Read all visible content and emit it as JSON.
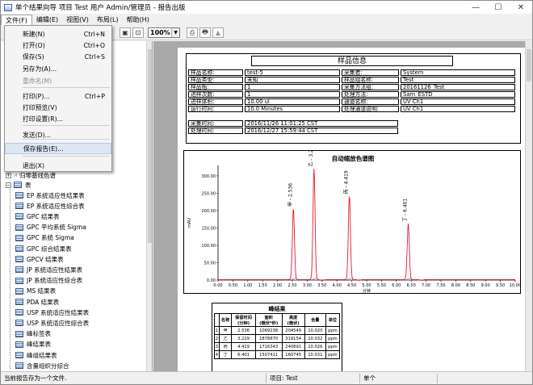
{
  "window": {
    "title": "单个结果向导 项目 Test 用户 Admin/管理员 - 报告出版",
    "buttons": [
      "—",
      "☐",
      "✕"
    ]
  },
  "menubar": [
    "文件(F)",
    "编辑(E)",
    "视图(V)",
    "布局(L)",
    "帮助(H)"
  ],
  "toolbar": {
    "zoom": "100%"
  },
  "file_menu": {
    "items": [
      {
        "label": "新建(N)",
        "shortcut": "Ctrl+N",
        "disabled": false
      },
      {
        "label": "打开(O)",
        "shortcut": "Ctrl+O",
        "disabled": false
      },
      {
        "label": "保存(S)",
        "shortcut": "Ctrl+S",
        "disabled": false
      },
      {
        "label": "另存为(A)...",
        "shortcut": "",
        "disabled": false
      },
      {
        "label": "重命名(M)",
        "shortcut": "",
        "disabled": true
      },
      {
        "label": "打印(P)...",
        "shortcut": "Ctrl+P",
        "disabled": false
      },
      {
        "label": "打印预览(V)",
        "shortcut": "",
        "disabled": false
      },
      {
        "label": "打印设置(R)...",
        "shortcut": "",
        "disabled": false
      },
      {
        "label": "发送(D)...",
        "shortcut": "",
        "disabled": false
      },
      {
        "label": "保存报告(E)...",
        "shortcut": "",
        "disabled": false
      },
      {
        "label": "退出(X)",
        "shortcut": "",
        "disabled": false
      }
    ]
  },
  "tree": {
    "group1": "归零基线色谱",
    "group2": "表",
    "items": [
      "EP 系统适应性结果表",
      "EP 系统适应性综合表",
      "GPC 结果表",
      "GPC 平均系统 Sigma",
      "GPC 系统 Sigma",
      "GPC 综合结果表",
      "GPCV 结果表",
      "JP 系统适应性结果表",
      "JP 系统适应性综合表",
      "MS 结果表",
      "PDA 结果表",
      "USP 系统适应性结果表",
      "USP 系统适应性综合表",
      "峰标签表",
      "峰结果表",
      "峰组结果表",
      "含量组织分综合"
    ]
  },
  "sample_info": {
    "title": "样品信息",
    "rows": [
      [
        "样品名称:",
        "test-5",
        "采集者:",
        "System"
      ],
      [
        "样品类型:",
        "未知",
        "样品组名称:",
        "Test"
      ],
      [
        "样品瓶:",
        "1",
        "采集方法组:",
        "20161126_Test"
      ],
      [
        "进样次数:",
        "1",
        "处理方法:",
        "Sam_ESTD"
      ],
      [
        "进样体积:",
        "10.00 ul",
        "通道名称:",
        "UV Ch1"
      ],
      [
        "运行时间:",
        "10.0 Minutes",
        "处理通道说明:",
        "UV Ch1"
      ]
    ],
    "acq_label": "采集时间:",
    "acq_date": "2016/11/26 11:01:25 CST",
    "proc_label": "处理时间:",
    "proc_date": "2016/12/27 15:59:44 CST"
  },
  "chart_data": {
    "type": "line",
    "title": "自动缩放色谱图",
    "xlabel": "分钟",
    "ylabel": "mAU",
    "xlim": [
      0,
      10
    ],
    "ylim": [
      0,
      330
    ],
    "xticks": [
      "0.00",
      "0.50",
      "1.00",
      "1.50",
      "2.00",
      "2.50",
      "3.00",
      "3.50",
      "4.00",
      "4.50",
      "5.00",
      "5.50",
      "6.00",
      "6.50",
      "7.00",
      "7.50",
      "8.00",
      "8.50",
      "9.00",
      "9.50",
      "10.00"
    ],
    "yticks": [
      "0.00",
      "50.00",
      "100.00",
      "150.00",
      "200.00",
      "250.00",
      "300.00"
    ],
    "peaks": [
      {
        "label": "甲 - 2.536",
        "rt": 2.536,
        "height": 204.5
      },
      {
        "label": "乙 - 3.229",
        "rt": 3.229,
        "height": 319.2
      },
      {
        "label": "丙 - 4.419",
        "rt": 4.419,
        "height": 240.9
      },
      {
        "label": "丁 - 6.401",
        "rt": 6.401,
        "height": 160.7
      }
    ]
  },
  "peak_table": {
    "title": "峰结果",
    "headers": [
      "",
      "名称",
      "保留时间\n(分钟)",
      "面积\n(微伏*秒)",
      "高度\n(微伏)",
      "含量",
      "单位"
    ],
    "rows": [
      [
        "1",
        "甲",
        "2.536",
        "1069238",
        "204549",
        "10.020",
        "ppm"
      ],
      [
        "2",
        "乙",
        "3.229",
        "1878870",
        "319154",
        "10.032",
        "ppm"
      ],
      [
        "3",
        "丙",
        "4.419",
        "1716343",
        "240891",
        "10.026",
        "ppm"
      ],
      [
        "4",
        "丁",
        "6.401",
        "1507411",
        "160745",
        "10.031",
        "ppm"
      ]
    ]
  },
  "status": {
    "message": "当前报告存为一个文件.",
    "project": "项目: Test",
    "mode": "单个"
  },
  "colors": {
    "trace": "#e8192c",
    "accent": "#3c5a8a"
  }
}
